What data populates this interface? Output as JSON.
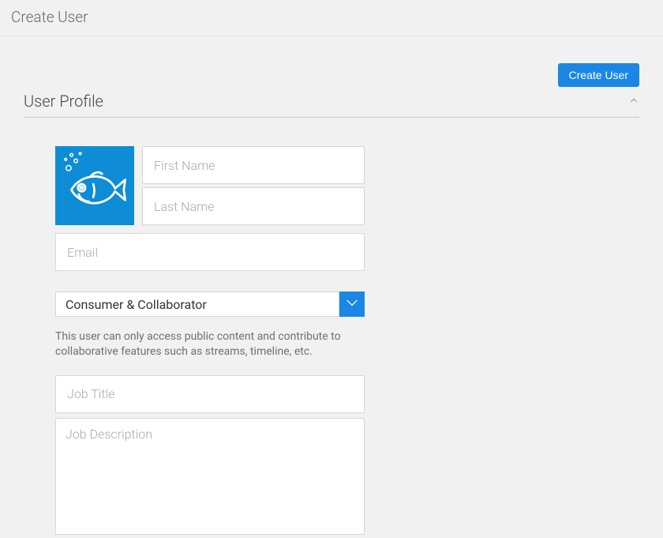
{
  "header": {
    "title": "Create User"
  },
  "actions": {
    "create_user_label": "Create User"
  },
  "section": {
    "title": "User Profile"
  },
  "form": {
    "first_name": {
      "value": "",
      "placeholder": "First Name"
    },
    "last_name": {
      "value": "",
      "placeholder": "Last Name"
    },
    "email": {
      "value": "",
      "placeholder": "Email"
    },
    "role": {
      "selected": "Consumer & Collaborator",
      "help": "This user can only access public content and contribute to collaborative features such as streams, timeline, etc."
    },
    "job_title": {
      "value": "",
      "placeholder": "Job Title"
    },
    "job_description": {
      "value": "",
      "placeholder": "Job Description"
    }
  },
  "colors": {
    "primary": "#1b87e5",
    "avatar_bg": "#0e8cd6"
  }
}
